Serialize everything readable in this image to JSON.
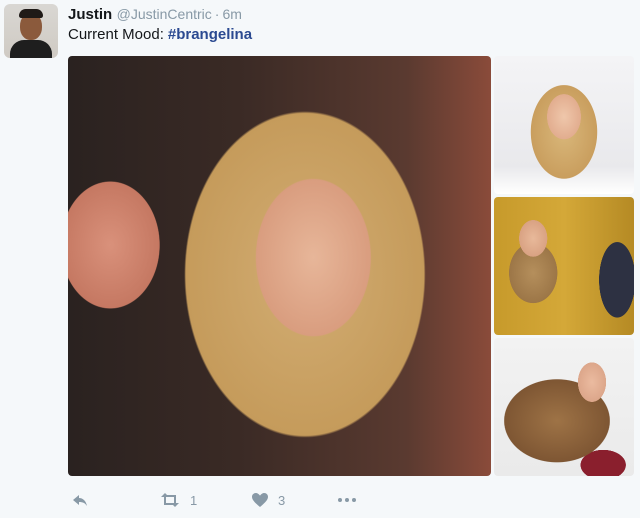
{
  "author": {
    "name": "Justin",
    "handle": "@JustinCentric",
    "time": "6m"
  },
  "tweet": {
    "text": "Current Mood:",
    "hashtag": "#brangelina"
  },
  "actions": {
    "retweet_count": "1",
    "like_count": "3"
  },
  "icons": {
    "reply": "reply-icon",
    "retweet": "retweet-icon",
    "like": "heart-icon",
    "more": "more-icon"
  },
  "colors": {
    "background": "#f5f8fa",
    "text": "#14171a",
    "muted": "#8899a6",
    "hashtag": "#2b4a91"
  }
}
